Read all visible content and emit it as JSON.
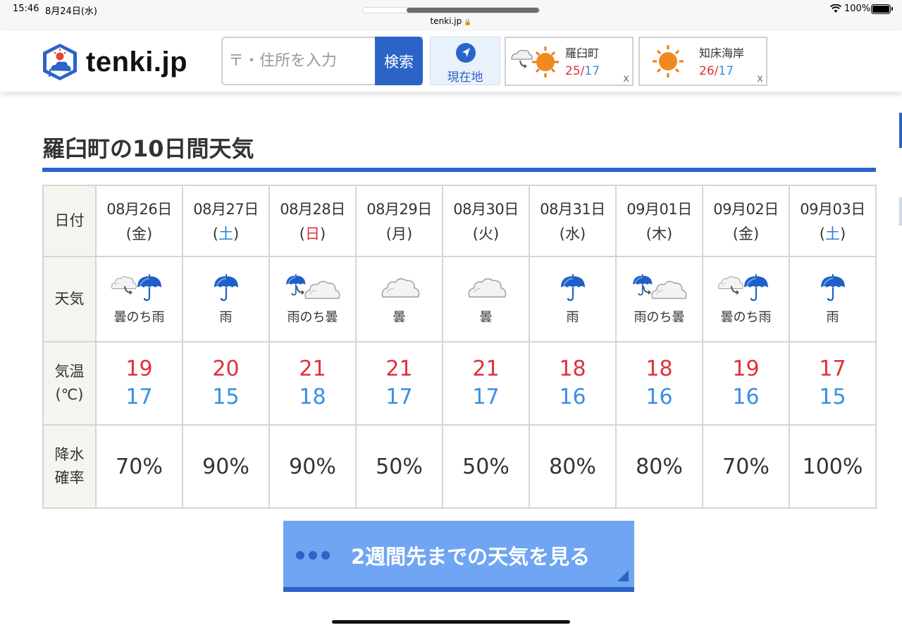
{
  "status_bar": {
    "time": "15:46",
    "date": "8月24日(水)",
    "url": "tenki.jp",
    "battery": "100%",
    "load_progress_fraction": 0.76
  },
  "header": {
    "logo_text": "tenki.jp",
    "search": {
      "placeholder": "〒・住所を入力",
      "button_label": "検索"
    },
    "location_button": "現在地",
    "recent": [
      {
        "name": "羅臼町",
        "high": "25",
        "low": "17",
        "icon": "cloud-then-sun-icon",
        "close": "x"
      },
      {
        "name": "知床海岸",
        "high": "26",
        "low": "17",
        "icon": "sun-icon",
        "close": "x"
      }
    ]
  },
  "title": "羅臼町の10日間天気",
  "table": {
    "row_labels": {
      "date": "日付",
      "weather": "天気",
      "temp_1": "気温",
      "temp_2": "(℃)",
      "rain_1": "降水",
      "rain_2": "確率"
    },
    "percent_sign": "%",
    "days": [
      {
        "date": "08月26日",
        "dow": "金",
        "dow_type": "weekday",
        "weather": "曇のち雨",
        "icon": "cloud-then-rain-icon",
        "high": "19",
        "low": "17",
        "rain": "70"
      },
      {
        "date": "08月27日",
        "dow": "土",
        "dow_type": "sat",
        "weather": "雨",
        "icon": "rain-icon",
        "high": "20",
        "low": "15",
        "rain": "90"
      },
      {
        "date": "08月28日",
        "dow": "日",
        "dow_type": "sun",
        "weather": "雨のち曇",
        "icon": "rain-then-cloud-icon",
        "high": "21",
        "low": "18",
        "rain": "90"
      },
      {
        "date": "08月29日",
        "dow": "月",
        "dow_type": "weekday",
        "weather": "曇",
        "icon": "cloud-icon",
        "high": "21",
        "low": "17",
        "rain": "50"
      },
      {
        "date": "08月30日",
        "dow": "火",
        "dow_type": "weekday",
        "weather": "曇",
        "icon": "cloud-icon",
        "high": "21",
        "low": "17",
        "rain": "50"
      },
      {
        "date": "08月31日",
        "dow": "水",
        "dow_type": "weekday",
        "weather": "雨",
        "icon": "rain-icon",
        "high": "18",
        "low": "16",
        "rain": "80"
      },
      {
        "date": "09月01日",
        "dow": "木",
        "dow_type": "weekday",
        "weather": "雨のち曇",
        "icon": "rain-then-cloud-icon",
        "high": "18",
        "low": "16",
        "rain": "80"
      },
      {
        "date": "09月02日",
        "dow": "金",
        "dow_type": "weekday",
        "weather": "曇のち雨",
        "icon": "cloud-then-rain-icon",
        "high": "19",
        "low": "16",
        "rain": "70"
      },
      {
        "date": "09月03日",
        "dow": "土",
        "dow_type": "sat",
        "weather": "雨",
        "icon": "rain-icon",
        "high": "17",
        "low": "15",
        "rain": "100"
      }
    ]
  },
  "more_button": {
    "label": "2週間先までの天気を見る"
  },
  "colors": {
    "accent": "#2b64c8",
    "high": "#e0303a",
    "low": "#3b8ee3",
    "button": "#6fa5f2"
  }
}
